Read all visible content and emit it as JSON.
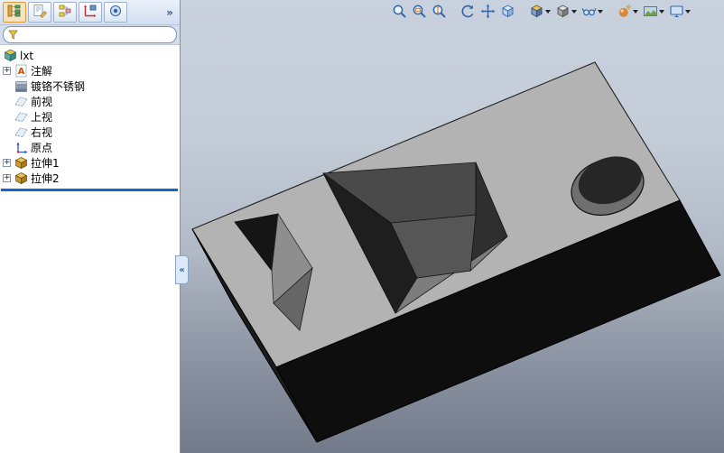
{
  "left_panel": {
    "manager_tabs": [
      {
        "icon": "featuremanager-tree-icon",
        "selected": true
      },
      {
        "icon": "propertymanager-icon",
        "selected": false
      },
      {
        "icon": "configurationmanager-icon",
        "selected": false
      },
      {
        "icon": "dimxpertmanager-icon",
        "selected": false
      },
      {
        "icon": "displaymanager-icon",
        "selected": false
      }
    ],
    "overflow_label": "»",
    "collapse_label": "«",
    "filter": {
      "value": ""
    },
    "tree": {
      "expander_symbol": "+",
      "annotation_icon_letter": "A",
      "root_label": "lxt",
      "items": [
        {
          "label": "注解",
          "icon": "annotations-icon",
          "expandable": true
        },
        {
          "label": "镀铬不锈钢",
          "icon": "material-icon",
          "expandable": false
        },
        {
          "label": "前视",
          "icon": "plane-icon",
          "expandable": false
        },
        {
          "label": "上视",
          "icon": "plane-icon",
          "expandable": false
        },
        {
          "label": "右视",
          "icon": "plane-icon",
          "expandable": false
        },
        {
          "label": "原点",
          "icon": "origin-icon",
          "expandable": false
        },
        {
          "label": "拉伸1",
          "icon": "extrude-icon",
          "expandable": true
        },
        {
          "label": "拉伸2",
          "icon": "extrude-icon",
          "expandable": true
        }
      ]
    }
  },
  "view_toolbar": {
    "icons": [
      "zoom-to-fit",
      "zoom-to-area",
      "zoom-in-out",
      "rotate-view",
      "pan",
      "3d-drawing-view",
      "view-orientation",
      "display-style",
      "hide-show-items",
      "edit-appearance",
      "apply-scene",
      "view-settings"
    ]
  },
  "viewport": {
    "background_top_color": "#c8d1de",
    "background_bottom_color": "#737b8a",
    "part_colors": {
      "top_face": "#b3b3b3",
      "front_left_face": "#1b1b1b",
      "front_right_face": "#0e0e0e",
      "pocket_floor": "#565656",
      "hole_inner": "#262626",
      "rollback_bar": "#1464d0"
    }
  }
}
